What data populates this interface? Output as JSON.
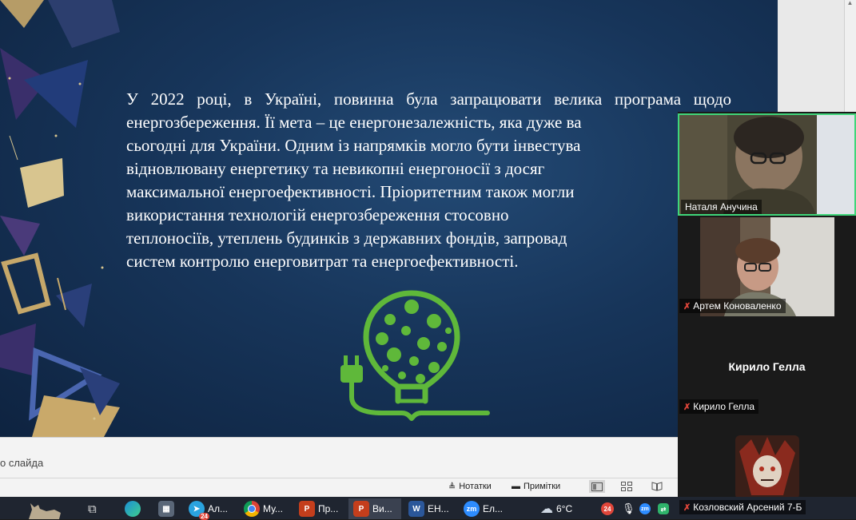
{
  "slide": {
    "text": "У 2022 році, в Україні, повинна була запрацювати велика програма щодо енергозбереження. Її мета – це енергонезалежність, яка дуже ва\nсьогодні для України. Одним із напрямків могло бути інвестува\nвідновлювану енергетику та невикопні енергоносії з досяг\nмаксимальної енергоефективності. Пріоритетним також могли\nвикористання технологій енергозбереження стосовно\nтеплоносіїв, утеплень будинків з державних фондів, запровад\nсистем контролю енерговитрат та енергоефективності."
  },
  "notes": {
    "placeholder": "о слайда"
  },
  "status_bar": {
    "notes_label": "Нотатки",
    "comments_label": "Примітки"
  },
  "participants": [
    {
      "name": "Наталя Анучина",
      "muted": false,
      "video": true
    },
    {
      "name": "Артем Коноваленко",
      "muted": true,
      "video": true
    },
    {
      "name": "Кирило Гелла",
      "muted": true,
      "video": false,
      "display_name": "Кирило Гелла"
    },
    {
      "name": "Козловский Арсений 7-Б",
      "muted": true,
      "video": false
    }
  ],
  "taskbar": {
    "items": [
      {
        "label": "Ал...",
        "icon": "telegram-icon",
        "badge": "24"
      },
      {
        "label": "Му...",
        "icon": "chrome-icon"
      },
      {
        "label": "Пр...",
        "icon": "powerpoint-icon"
      },
      {
        "label": "Ви...",
        "icon": "powerpoint-icon"
      },
      {
        "label": "ЕН...",
        "icon": "word-icon"
      },
      {
        "label": "Ел...",
        "icon": "zoom-icon"
      }
    ],
    "weather": "6°C",
    "tray_badge": "24"
  },
  "colors": {
    "slide_bg": "#17355a",
    "bulb_green": "#5fb83a",
    "zoom_active_border": "#3fd67a",
    "taskbar_bg": "#1f2530"
  }
}
